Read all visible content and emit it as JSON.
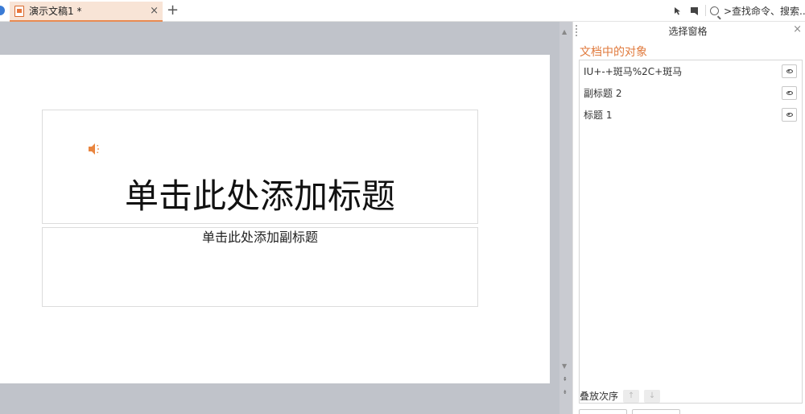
{
  "tabbar": {
    "doc_tab_title": "演示文稿1 *",
    "close_glyph": "×",
    "new_tab_glyph": "+",
    "search_placeholder": ">查找命令、搜索..."
  },
  "slide": {
    "title_placeholder": "单击此处添加标题",
    "subtitle_placeholder": "单击此处添加副标题"
  },
  "selection_pane": {
    "title": "选择窗格",
    "close_glyph": "×",
    "section_title": "文档中的对象",
    "objects": [
      {
        "label": "IU+-+斑马%2C+斑马"
      },
      {
        "label": "副标题 2"
      },
      {
        "label": "标题 1"
      }
    ],
    "order_label": "叠放次序"
  },
  "colors": {
    "accent": "#e07a3d",
    "tab_active_bg": "#f8e4d6",
    "canvas_bg": "#c0c3ca"
  },
  "icons": [
    "doc-icon",
    "close-icon",
    "plus-icon",
    "cursor-icon",
    "comment-icon",
    "search-icon",
    "sound-icon",
    "eye-icon",
    "move-up-icon",
    "move-down-icon"
  ]
}
